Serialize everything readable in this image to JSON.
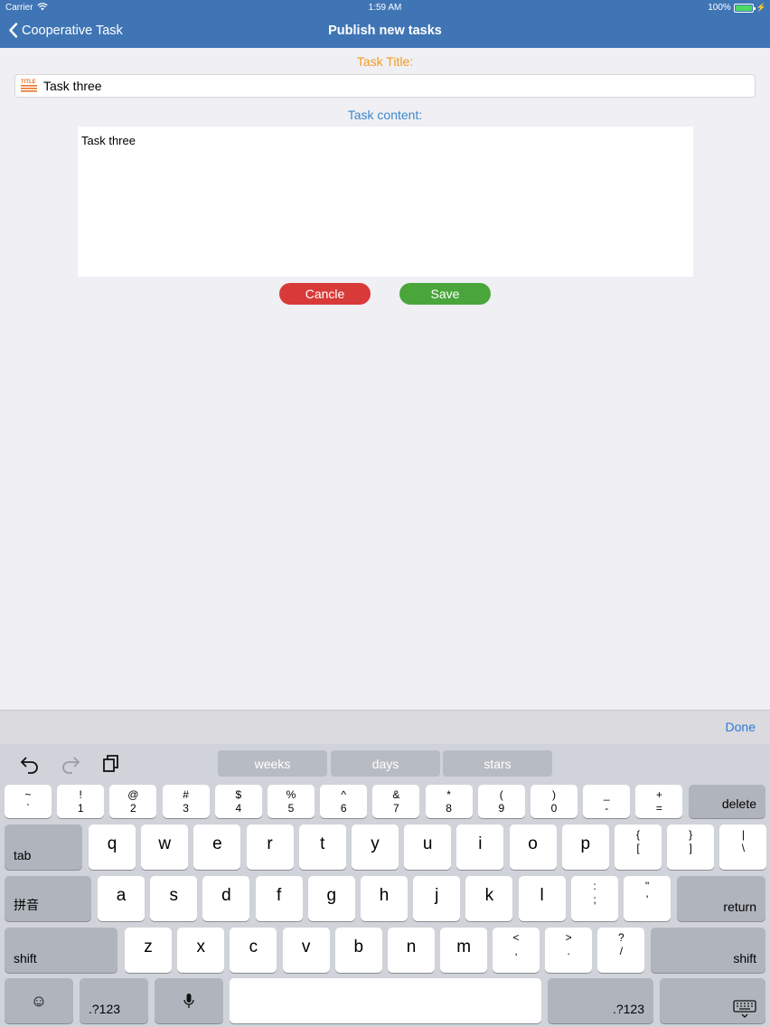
{
  "status_bar": {
    "carrier": "Carrier",
    "time": "1:59 AM",
    "battery": "100%",
    "battery_level": 1.0
  },
  "nav": {
    "back_label": "Cooperative Task",
    "title": "Publish new tasks"
  },
  "form": {
    "title_label": "Task Title:",
    "title_value": "Task three",
    "title_icon_text": "TITLE",
    "content_label": "Task content:",
    "content_value": "Task three",
    "cancel_label": "Cancle",
    "save_label": "Save"
  },
  "keyboard": {
    "done_label": "Done",
    "predictions": [
      "weeks",
      "days",
      "stars"
    ],
    "row1": [
      {
        "top": "~",
        "bottom": "`"
      },
      {
        "top": "!",
        "bottom": "1"
      },
      {
        "top": "@",
        "bottom": "2"
      },
      {
        "top": "#",
        "bottom": "3"
      },
      {
        "top": "$",
        "bottom": "4"
      },
      {
        "top": "%",
        "bottom": "5"
      },
      {
        "top": "^",
        "bottom": "6"
      },
      {
        "top": "&",
        "bottom": "7"
      },
      {
        "top": "*",
        "bottom": "8"
      },
      {
        "top": "(",
        "bottom": "9"
      },
      {
        "top": ")",
        "bottom": "0"
      },
      {
        "top": "_",
        "bottom": "-"
      },
      {
        "top": "+",
        "bottom": "="
      }
    ],
    "delete_label": "delete",
    "tab_label": "tab",
    "row2": [
      "q",
      "w",
      "e",
      "r",
      "t",
      "y",
      "u",
      "i",
      "o",
      "p"
    ],
    "row2_punct": [
      {
        "top": "{",
        "bottom": "["
      },
      {
        "top": "}",
        "bottom": "]"
      },
      {
        "top": "|",
        "bottom": "\\"
      }
    ],
    "pinyin_label": "拼音",
    "row3": [
      "a",
      "s",
      "d",
      "f",
      "g",
      "h",
      "j",
      "k",
      "l"
    ],
    "row3_punct": [
      {
        "top": ":",
        "bottom": ";"
      },
      {
        "top": "\"",
        "bottom": "'"
      }
    ],
    "return_label": "return",
    "shift_label": "shift",
    "row4": [
      "z",
      "x",
      "c",
      "v",
      "b",
      "n",
      "m"
    ],
    "row4_punct": [
      {
        "top": "<",
        "bottom": ","
      },
      {
        "top": ">",
        "bottom": "."
      },
      {
        "top": "?",
        "bottom": "/"
      }
    ],
    "numbers_label": ".?123",
    "emoji_glyph": "☺",
    "mic_glyph": "🎙"
  }
}
